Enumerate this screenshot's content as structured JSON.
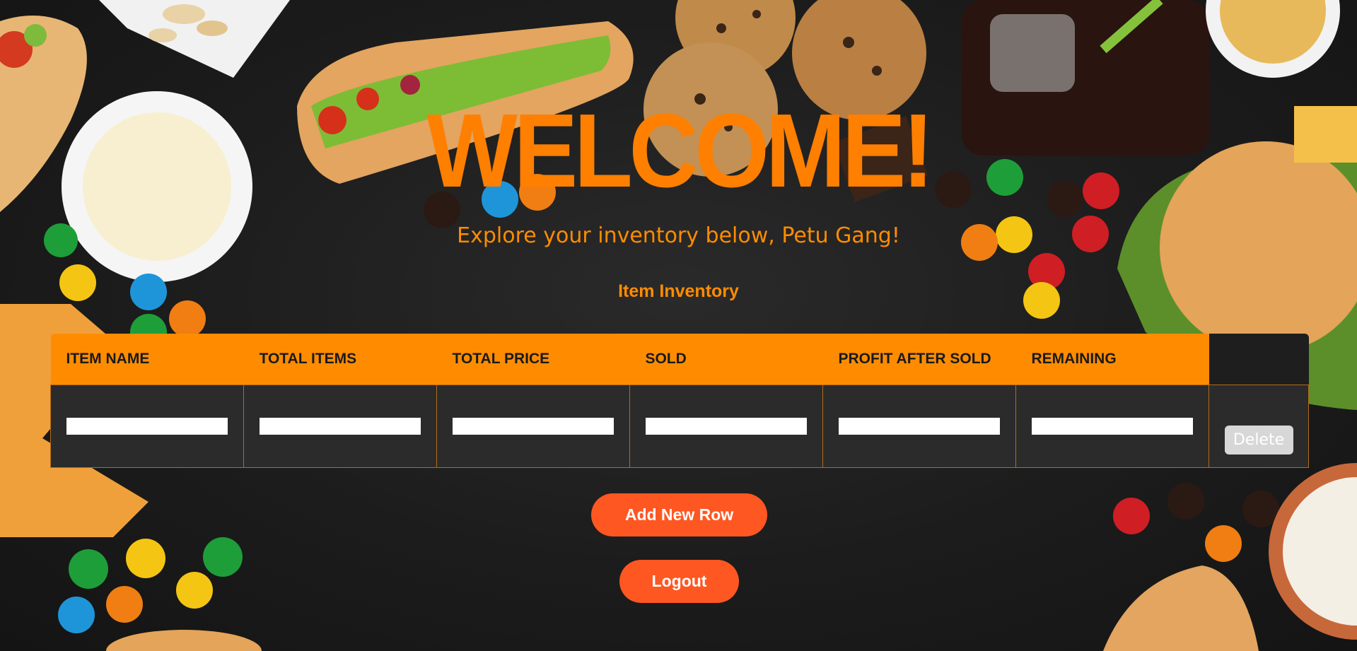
{
  "page": {
    "heading": "WELCOME!",
    "subtitle": "Explore your inventory below, Petu Gang!",
    "section_title": "Item Inventory"
  },
  "colors": {
    "accent_orange": "#ff8c00",
    "button_red_orange": "#ff5722",
    "table_body": "#2b2b2b",
    "background": "#1b1b1b"
  },
  "table": {
    "columns": [
      "ITEM NAME",
      "TOTAL ITEMS",
      "TOTAL PRICE",
      "SOLD",
      "PROFIT AFTER SOLD",
      "REMAINING"
    ],
    "rows": [
      {
        "item_name": "",
        "total_items": "",
        "total_price": "",
        "sold": "",
        "profit_after_sold": "",
        "remaining": "",
        "delete_label": "Delete"
      }
    ]
  },
  "actions": {
    "add_row_label": "Add New Row",
    "logout_label": "Logout"
  },
  "background_image": {
    "description_icons": [
      "hotdog",
      "cookies",
      "soda-glass",
      "burger",
      "candies",
      "nachos",
      "dip-bowl",
      "popcorn",
      "nuts"
    ]
  }
}
